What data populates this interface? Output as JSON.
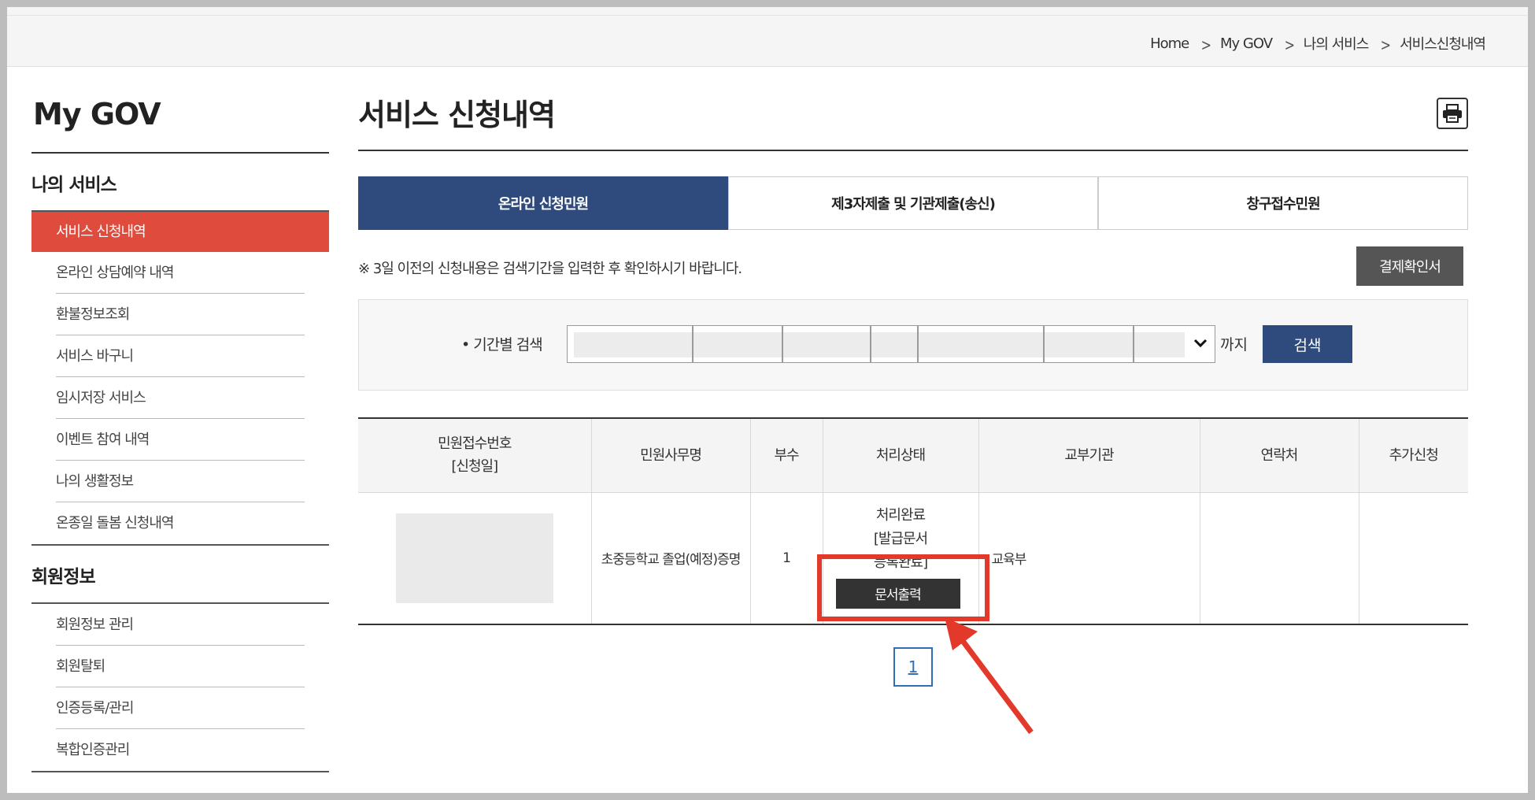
{
  "breadcrumb": [
    "Home",
    "My GOV",
    "나의 서비스",
    "서비스신청내역"
  ],
  "breadcrumb_separator": ">",
  "sidebar": {
    "title": "My GOV",
    "section1": "나의 서비스",
    "items1": [
      "서비스 신청내역",
      "온라인 상담예약 내역",
      "환불정보조회",
      "서비스 바구니",
      "임시저장 서비스",
      "이벤트 참여 내역",
      "나의 생활정보",
      "온종일 돌봄 신청내역"
    ],
    "active_index": 0,
    "section2": "회원정보",
    "items2": [
      "회원정보 관리",
      "회원탈퇴",
      "인증등록/관리",
      "복합인증관리"
    ]
  },
  "main": {
    "title": "서비스 신청내역",
    "print_icon": "printer-icon",
    "tabs": [
      "온라인 신청민원",
      "제3자제출 및 기관제출(송신)",
      "창구접수민원"
    ],
    "active_tab": 0,
    "notice": "※ 3일 이전의 신청내용은 검색기간을 입력한 후 확인하시기 바랍니다.",
    "receipt_button": "결제확인서",
    "search": {
      "label": "• 기간별 검색",
      "until": "까지",
      "button": "검색"
    },
    "table": {
      "headers": [
        "민원접수번호\n[신청일]",
        "민원사무명",
        "부수",
        "처리상태",
        "교부기관",
        "연락처",
        "추가신청"
      ],
      "header_col0_line1": "민원접수번호",
      "header_col0_line2": "[신청일]",
      "row": {
        "service": "초중등학교 졸업(예정)증명",
        "copies": "1",
        "status_lines": [
          "처리완료",
          "[발급문서",
          "등록완료]"
        ],
        "print_button": "문서출력",
        "agency": "교육부",
        "contact": "",
        "additional": ""
      }
    },
    "pagination": [
      "1"
    ]
  },
  "colors": {
    "active_sidebar": "#df4c3e",
    "active_tab": "#2f4a7c",
    "highlight": "#e2392b"
  }
}
